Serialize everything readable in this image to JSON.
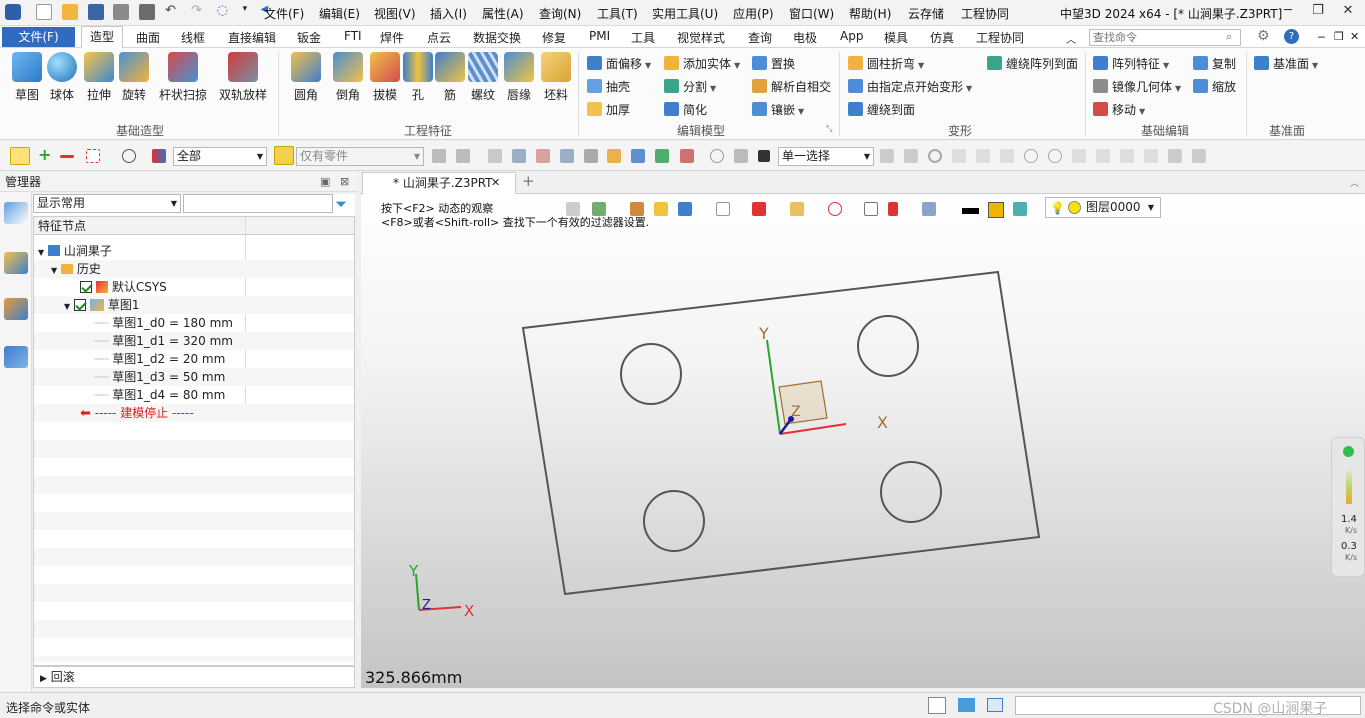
{
  "titlebar": {
    "window_title": "中望3D 2024 x64 - [* 山涧果子.Z3PRT]",
    "menus": [
      "文件(F)",
      "编辑(E)",
      "视图(V)",
      "插入(I)",
      "属性(A)",
      "查询(N)",
      "工具(T)",
      "实用工具(U)",
      "应用(P)",
      "窗口(W)",
      "帮助(H)",
      "云存储",
      "工程协同"
    ]
  },
  "ribbon_tabs": {
    "file": "文件(F)",
    "tabs": [
      "造型",
      "曲面",
      "线框",
      "直接编辑",
      "钣金",
      "FTI",
      "焊件",
      "点云",
      "数据交换",
      "修复",
      "PMI",
      "工具",
      "视觉样式",
      "查询",
      "电极",
      "App",
      "模具",
      "仿真",
      "工程协同"
    ],
    "search_placeholder": "查找命令"
  },
  "ribbon": {
    "basic_shape": {
      "label": "基础造型",
      "buttons": [
        "草图",
        "球体",
        "拉伸",
        "旋转",
        "杆状扫掠",
        "双轨放样"
      ]
    },
    "eng_features": {
      "label": "工程特征",
      "buttons": [
        "圆角",
        "倒角",
        "拔模",
        "孔",
        "筋",
        "螺纹",
        "唇缘",
        "坯料"
      ]
    },
    "edit_model": {
      "label": "编辑模型",
      "buttons": [
        "面偏移",
        "添加实体",
        "置换",
        "抽壳",
        "分割",
        "解析自相交",
        "加厚",
        "简化",
        "镶嵌"
      ]
    },
    "deform": {
      "label": "变形",
      "buttons": [
        "圆柱折弯",
        "缠绕阵列到面",
        "由指定点开始变形",
        "缠绕到面"
      ]
    },
    "basic_edit": {
      "label": "基础编辑",
      "buttons": [
        "阵列特征",
        "复制",
        "镜像几何体",
        "缩放",
        "移动"
      ]
    },
    "datum": {
      "label": "基准面",
      "buttons": [
        "基准面"
      ]
    }
  },
  "toolbar2": {
    "filter_all": "全部",
    "filter_parts": "仅有零件",
    "select_mode": "单一选择"
  },
  "manager": {
    "title": "管理器",
    "display_mode": "显示常用",
    "feature_header": "特征节点",
    "tree": [
      {
        "label": "山涧果子",
        "level": 0
      },
      {
        "label": "历史",
        "level": 1
      },
      {
        "label": "默认CSYS",
        "level": 2
      },
      {
        "label": "草图1",
        "level": 2
      },
      {
        "label": "草图1_d0 = 180 mm",
        "level": 3
      },
      {
        "label": "草图1_d1 = 320 mm",
        "level": 3
      },
      {
        "label": "草图1_d2 = 20 mm",
        "level": 3
      },
      {
        "label": "草图1_d3 = 50 mm",
        "level": 3
      },
      {
        "label": "草图1_d4 = 80 mm",
        "level": 3
      }
    ],
    "stop_marker": "----- 建模停止 -----",
    "rollback": "回滚"
  },
  "document": {
    "tab_label": "* 山涧果子.Z3PRT",
    "hint_line1": "按下<F2> 动态的观察",
    "hint_line2": "<F8>或者<Shift-roll> 查找下一个有效的过滤器设置.",
    "layer": "图层0000",
    "measure": "325.866mm",
    "axis_x": "X",
    "axis_y": "Y",
    "axis_z": "Z",
    "perf_val1": "1.4",
    "perf_unit1": "K/s",
    "perf_val2": "0.3",
    "perf_unit2": "K/s"
  },
  "status": {
    "prompt": "选择命令或实体",
    "watermark": "CSDN @山涧果子"
  },
  "colors": {
    "accent": "#2f6bc0",
    "stop": "#e02020"
  }
}
